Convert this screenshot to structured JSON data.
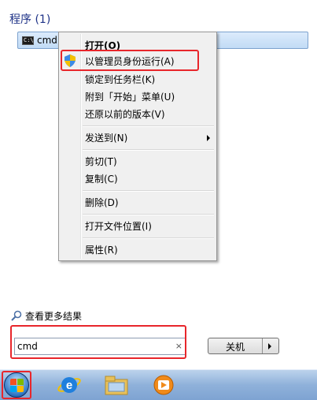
{
  "start_menu": {
    "section_title": "程序 (1)",
    "result": {
      "label": "cmd",
      "icon": "cmd-icon",
      "icon_text": "C:\\"
    },
    "see_more": "查看更多结果",
    "search": {
      "value": "cmd",
      "clear_glyph": "×"
    },
    "shutdown": {
      "label": "关机"
    }
  },
  "context_menu": {
    "items": [
      {
        "label": "打开(O)",
        "bold": true
      },
      {
        "label": "以管理员身份运行(A)",
        "icon": "uac-shield-icon"
      },
      {
        "label": "锁定到任务栏(K)"
      },
      {
        "label": "附到「开始」菜单(U)"
      },
      {
        "label": "还原以前的版本(V)"
      },
      {
        "label": "发送到(N)",
        "submenu": true
      },
      {
        "label": "剪切(T)"
      },
      {
        "label": "复制(C)"
      },
      {
        "label": "删除(D)"
      },
      {
        "label": "打开文件位置(I)"
      },
      {
        "label": "属性(R)"
      }
    ]
  },
  "taskbar": {
    "items": [
      "start-orb",
      "internet-explorer-icon",
      "file-explorer-icon",
      "media-player-icon"
    ]
  },
  "colors": {
    "highlight_red": "#e8262b",
    "selection_blue": "#c1dbf5",
    "title_blue": "#1e3287"
  }
}
